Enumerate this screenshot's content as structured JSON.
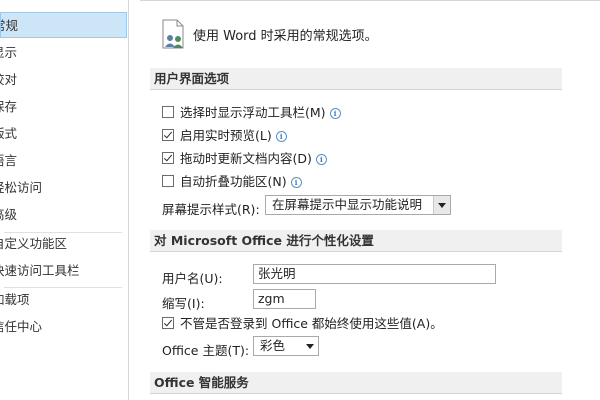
{
  "sidebar": {
    "items": [
      {
        "label": "常规",
        "selected": true
      },
      {
        "label": "显示"
      },
      {
        "label": "校对"
      },
      {
        "label": "保存"
      },
      {
        "label": "版式"
      },
      {
        "label": "语言"
      },
      {
        "label": "轻松访问"
      },
      {
        "label": "高级"
      },
      {
        "label": "自定义功能区"
      },
      {
        "label": "快速访问工具栏"
      },
      {
        "label": "加载项"
      },
      {
        "label": "信任中心"
      }
    ]
  },
  "header": {
    "icon": "options-people-icon",
    "text": "使用 Word 时采用的常规选项。"
  },
  "ui_options": {
    "title": "用户界面选项",
    "checkboxes": [
      {
        "label": "选择时显示浮动工具栏(M)",
        "checked": false
      },
      {
        "label": "启用实时预览(L)",
        "checked": true
      },
      {
        "label": "拖动时更新文档内容(D)",
        "checked": true
      },
      {
        "label": "自动折叠功能区(N)",
        "checked": false
      }
    ],
    "screentip_label": "屏幕提示样式(R):",
    "screentip_value": "在屏幕提示中显示功能说明"
  },
  "personalize": {
    "title": "对 Microsoft Office 进行个性化设置",
    "username_label": "用户名(U):",
    "username_value": "张光明",
    "initials_label": "缩写(I):",
    "initials_value": "zgm",
    "always_use_label": "不管是否登录到 Office 都始终使用这些值(A)。",
    "always_use_checked": true,
    "theme_label": "Office 主题(T):",
    "theme_value": "彩色"
  },
  "intelligent": {
    "title": "Office 智能服务"
  },
  "colors": {
    "selected_bg": "#cde6f7",
    "section_bg": "#f0f0f0",
    "info_blue": "#3d7ac0"
  }
}
